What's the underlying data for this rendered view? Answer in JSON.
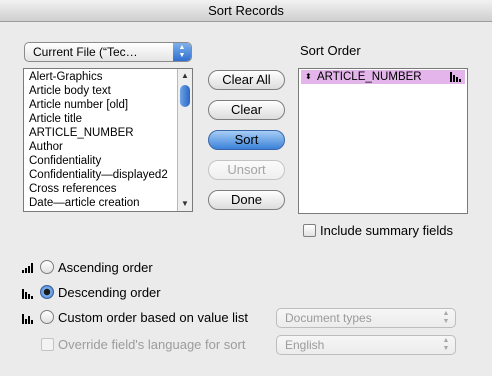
{
  "window": {
    "title": "Sort Records"
  },
  "source_popup": {
    "value": "Current File (“Tec…"
  },
  "field_list": {
    "items": [
      "Alert-Graphics",
      "Article body text",
      "Article number [old]",
      "Article title",
      "ARTICLE_NUMBER",
      "Author",
      "Confidentiality",
      "Confidentiality—displayed2",
      "Cross references",
      "Date—article creation"
    ]
  },
  "buttons": {
    "clear_all": "Clear All",
    "clear": "Clear",
    "sort": "Sort",
    "unsort": "Unsort",
    "done": "Done"
  },
  "sort_order": {
    "heading": "Sort Order",
    "items": [
      {
        "field": "ARTICLE_NUMBER",
        "order": "descending"
      }
    ]
  },
  "summary_checkbox": {
    "label": "Include summary fields",
    "checked": false
  },
  "radio_options": {
    "ascending": "Ascending order",
    "descending": "Descending order",
    "custom": "Custom order based on value list",
    "selected": "descending"
  },
  "value_list_popup": {
    "value": "Document types"
  },
  "override_checkbox": {
    "label": "Override field's language for sort",
    "checked": false
  },
  "language_popup": {
    "value": "English"
  },
  "colors": {
    "sort_row_highlight": "#e3b5ea",
    "accent": "#3b82d9"
  }
}
